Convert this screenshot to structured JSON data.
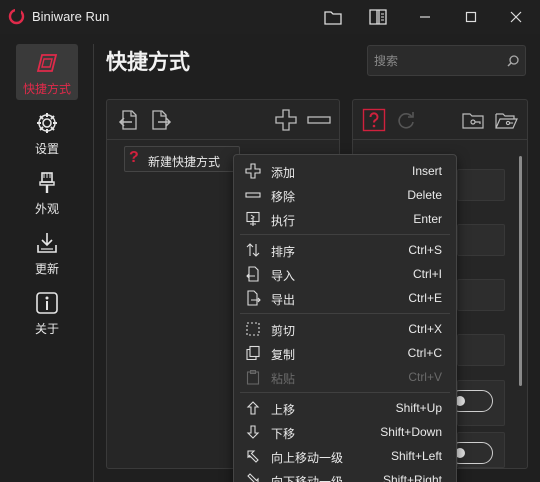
{
  "app": {
    "title": "Biniware Run",
    "accent": "#e02a4a"
  },
  "window_controls": [
    "folder-icon",
    "book-icon",
    "minimize-icon",
    "maximize-icon",
    "close-icon"
  ],
  "nav": {
    "items": [
      {
        "label": "快捷方式",
        "icon": "shortcut-icon",
        "active": true
      },
      {
        "label": "设置",
        "icon": "gear-icon",
        "active": false
      },
      {
        "label": "外观",
        "icon": "brush-icon",
        "active": false
      },
      {
        "label": "更新",
        "icon": "download-icon",
        "active": false
      },
      {
        "label": "关于",
        "icon": "info-icon",
        "active": false
      }
    ]
  },
  "page": {
    "title": "快捷方式"
  },
  "search": {
    "placeholder": "搜索"
  },
  "left_panel": {
    "tools": [
      "import-icon",
      "export-icon",
      "add-icon",
      "remove-icon"
    ],
    "list": [
      {
        "label": "新建快捷方式",
        "icon": "question-icon"
      }
    ]
  },
  "right_panel": {
    "tools": [
      "question-icon",
      "refresh-icon",
      "folder-key-icon",
      "folder-open-icon"
    ]
  },
  "context_menu": {
    "items": [
      {
        "label": "添加",
        "shortcut": "Insert",
        "icon": "add-icon",
        "enabled": true
      },
      {
        "label": "移除",
        "shortcut": "Delete",
        "icon": "remove-icon",
        "enabled": true
      },
      {
        "label": "执行",
        "shortcut": "Enter",
        "icon": "run-icon",
        "enabled": true
      },
      {
        "label": "排序",
        "shortcut": "Ctrl+S",
        "icon": "sort-icon",
        "enabled": true
      },
      {
        "label": "导入",
        "shortcut": "Ctrl+I",
        "icon": "import-icon",
        "enabled": true
      },
      {
        "label": "导出",
        "shortcut": "Ctrl+E",
        "icon": "export-icon",
        "enabled": true
      },
      {
        "label": "剪切",
        "shortcut": "Ctrl+X",
        "icon": "cut-icon",
        "enabled": true
      },
      {
        "label": "复制",
        "shortcut": "Ctrl+C",
        "icon": "copy-icon",
        "enabled": true
      },
      {
        "label": "粘贴",
        "shortcut": "Ctrl+V",
        "icon": "paste-icon",
        "enabled": false
      },
      {
        "label": "上移",
        "shortcut": "Shift+Up",
        "icon": "arrow-up-icon",
        "enabled": true
      },
      {
        "label": "下移",
        "shortcut": "Shift+Down",
        "icon": "arrow-down-icon",
        "enabled": true
      },
      {
        "label": "向上移动一级",
        "shortcut": "Shift+Left",
        "icon": "level-up-icon",
        "enabled": true
      },
      {
        "label": "向下移动一级",
        "shortcut": "Shift+Right",
        "icon": "level-down-icon",
        "enabled": true
      }
    ]
  }
}
